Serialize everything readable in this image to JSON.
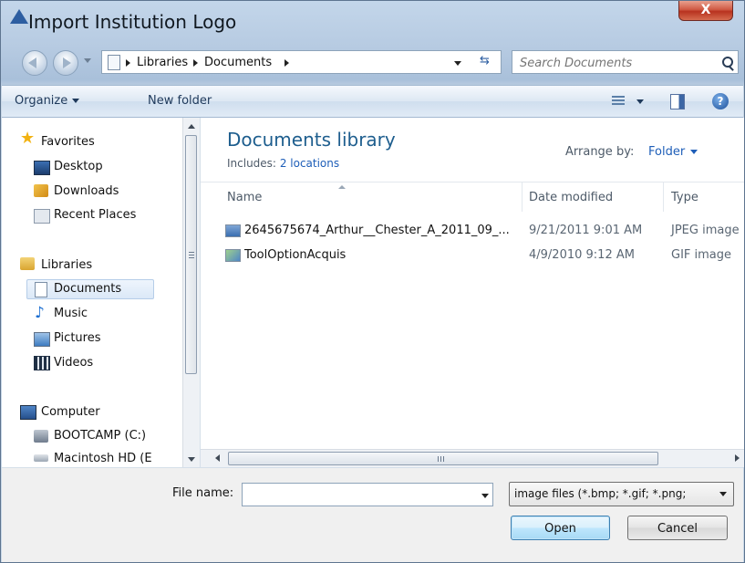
{
  "window": {
    "title": "Import Institution Logo",
    "close_label": "X"
  },
  "address_bar": {
    "crumbs": [
      "Libraries",
      "Documents"
    ]
  },
  "search": {
    "placeholder": "Search Documents"
  },
  "toolbar": {
    "organize_label": "Organize",
    "new_folder_label": "New folder"
  },
  "nav": {
    "favorites_label": "Favorites",
    "favorites": [
      "Desktop",
      "Downloads",
      "Recent Places"
    ],
    "libraries_label": "Libraries",
    "libraries": [
      "Documents",
      "Music",
      "Pictures",
      "Videos"
    ],
    "computer_label": "Computer",
    "computer": [
      "BOOTCAMP (C:)",
      "Macintosh HD (E"
    ]
  },
  "library": {
    "title": "Documents library",
    "includes_prefix": "Includes:",
    "includes_link": "2 locations",
    "arrange_label": "Arrange by:",
    "arrange_value": "Folder"
  },
  "columns": {
    "name": "Name",
    "date": "Date modified",
    "type": "Type"
  },
  "files": [
    {
      "name": "2645675674_Arthur__Chester_A_2011_09_...",
      "date": "9/21/2011 9:01 AM",
      "type": "JPEG image"
    },
    {
      "name": "ToolOptionAcquis",
      "date": "4/9/2010 9:12 AM",
      "type": "GIF image"
    }
  ],
  "hscroll": {
    "grip": "III"
  },
  "bottom": {
    "file_name_label": "File name:",
    "file_name_value": "",
    "filter_value": "image files (*.bmp; *.gif; *.png;",
    "open_label": "Open",
    "cancel_label": "Cancel"
  },
  "colors": {
    "accent_title": "#1e5e8e",
    "link": "#1e5eb8",
    "close": "#c94a33"
  }
}
